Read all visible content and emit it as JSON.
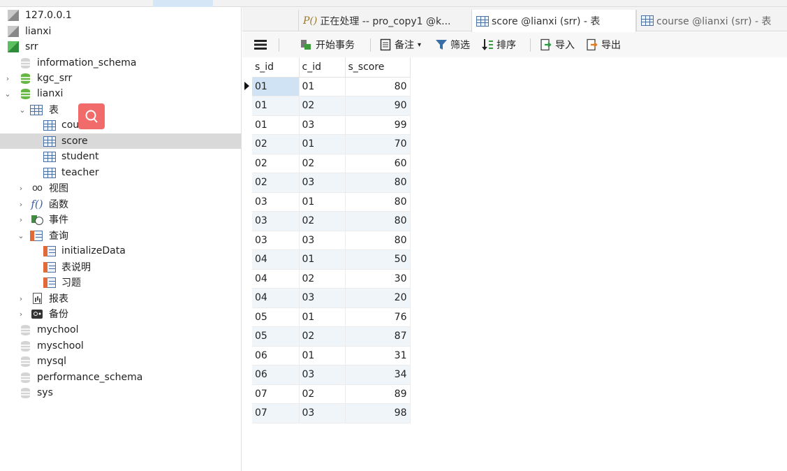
{
  "sidebar": {
    "connections": [
      "127.0.0.1",
      "lianxi",
      "srr"
    ],
    "databases_top": [
      "information_schema",
      "kgc_srr",
      "lianxi"
    ],
    "tables_folder": "表",
    "tables": [
      "course",
      "score",
      "student",
      "teacher"
    ],
    "views": "视图",
    "functions": "函数",
    "events": "事件",
    "queries_folder": "查询",
    "queries": [
      "initializeData",
      "表说明",
      "习题"
    ],
    "reports": "报表",
    "backups": "备份",
    "databases_bottom": [
      "mychool",
      "myschool",
      "mysql",
      "performance_schema",
      "sys"
    ]
  },
  "tabs": [
    {
      "label": "正在处理 -- pro_copy1 @k..."
    },
    {
      "label": "score @lianxi (srr) - 表"
    },
    {
      "label": "course @lianxi (srr) - 表"
    }
  ],
  "toolbar": {
    "begin_transaction": "开始事务",
    "memo": "备注",
    "filter": "筛选",
    "sort": "排序",
    "import": "导入",
    "export": "导出"
  },
  "grid": {
    "columns": [
      "s_id",
      "c_id",
      "s_score"
    ],
    "rows": [
      [
        "01",
        "01",
        "80"
      ],
      [
        "01",
        "02",
        "90"
      ],
      [
        "01",
        "03",
        "99"
      ],
      [
        "02",
        "01",
        "70"
      ],
      [
        "02",
        "02",
        "60"
      ],
      [
        "02",
        "03",
        "80"
      ],
      [
        "03",
        "01",
        "80"
      ],
      [
        "03",
        "02",
        "80"
      ],
      [
        "03",
        "03",
        "80"
      ],
      [
        "04",
        "01",
        "50"
      ],
      [
        "04",
        "02",
        "30"
      ],
      [
        "04",
        "03",
        "20"
      ],
      [
        "05",
        "01",
        "76"
      ],
      [
        "05",
        "02",
        "87"
      ],
      [
        "06",
        "01",
        "31"
      ],
      [
        "06",
        "03",
        "34"
      ],
      [
        "07",
        "02",
        "89"
      ],
      [
        "07",
        "03",
        "98"
      ]
    ]
  },
  "colors": {
    "accent": "#f26b6b",
    "selection": "#d9d9d9",
    "row_alt": "#f0f5fa",
    "cell_selected": "#cfe3f5"
  }
}
